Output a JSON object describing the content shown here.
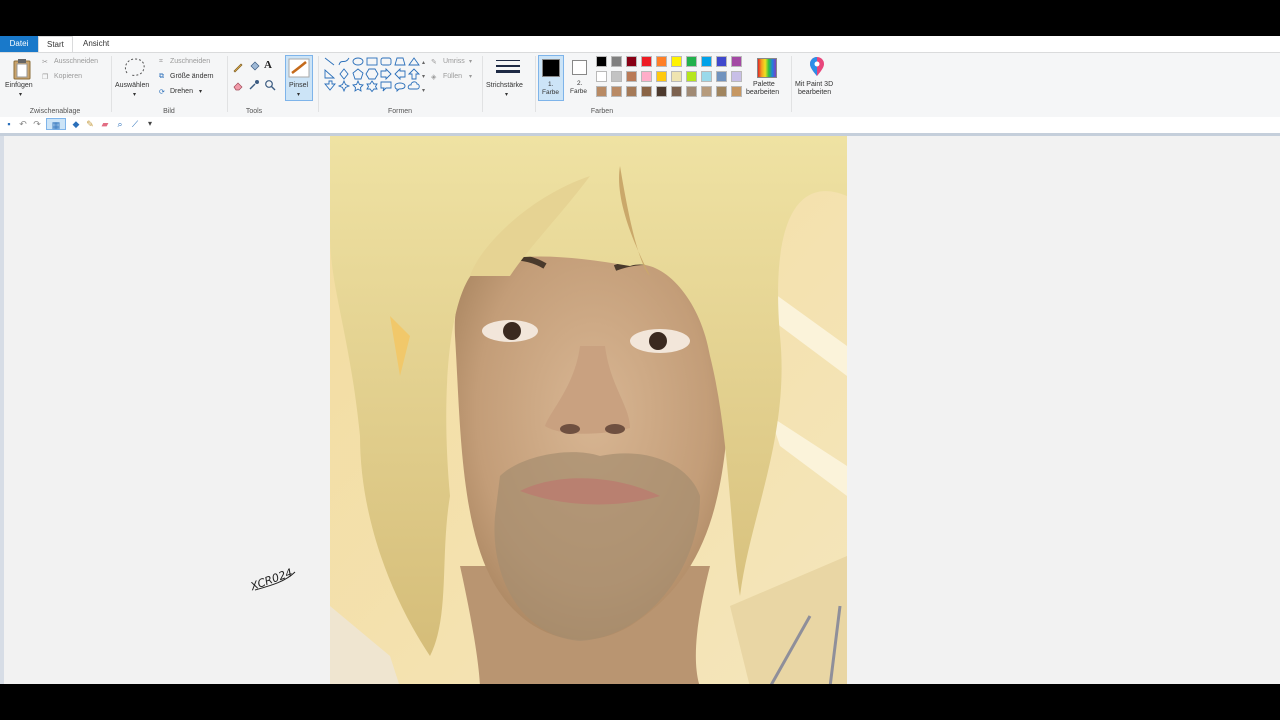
{
  "tabs": {
    "file": "Datei",
    "start": "Start",
    "view": "Ansicht"
  },
  "clipboard": {
    "paste": "Einfügen",
    "cut": "Ausschneiden",
    "copy": "Kopieren",
    "label": "Zwischenablage"
  },
  "image": {
    "select": "Auswählen",
    "crop": "Zuschneiden",
    "resize": "Größe ändern",
    "rotate": "Drehen",
    "label": "Bild"
  },
  "tools": {
    "label": "Tools",
    "text_tool_glyph": "A"
  },
  "brushes": {
    "label": "Pinsel"
  },
  "shapes": {
    "outline": "Umriss",
    "fill": "Füllen",
    "label": "Formen"
  },
  "stroke": {
    "label": "Strichstärke"
  },
  "colors": {
    "color1_line1": "1.",
    "color1_line2": "Farbe",
    "color2_line1": "2.",
    "color2_line2": "Farbe",
    "palette_line1": "Palette",
    "palette_line2": "bearbeiten",
    "paint3d_line1": "Mit Paint 3D",
    "paint3d_line2": "bearbeiten",
    "label": "Farben",
    "color1": "#000000",
    "color2": "#ffffff",
    "row1": [
      "#000000",
      "#7f7f7f",
      "#880015",
      "#ed1c24",
      "#ff7f27",
      "#fff200",
      "#22b14c",
      "#00a2e8",
      "#3f48cc",
      "#a349a4"
    ],
    "row2": [
      "#ffffff",
      "#c3c3c3",
      "#b97a57",
      "#ffaec9",
      "#ffc90e",
      "#efe4b0",
      "#b5e61d",
      "#99d9ea",
      "#7092be",
      "#c8bfe7"
    ],
    "row3": [
      "#b88a64",
      "#b98a65",
      "#a57a58",
      "#8a6446",
      "#4d3a2e",
      "#7c624f",
      "#a08a74",
      "#b69b7d",
      "#a0855f",
      "#c69762"
    ]
  },
  "canvas": {
    "signature": "XCR024"
  }
}
